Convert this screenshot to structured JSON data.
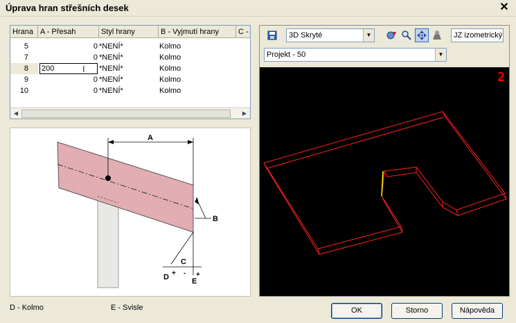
{
  "window": {
    "title": "Úprava hran střešních desek"
  },
  "grid": {
    "columns": [
      "Hrana",
      "A - Přesah",
      "Styl hrany",
      "B - Vyjmutí hrany",
      "C -"
    ],
    "rows": [
      {
        "hrana": "5",
        "presah": "0",
        "styl": "*NENÍ*",
        "vyjmuti": "Kolmo"
      },
      {
        "hrana": "7",
        "presah": "0",
        "styl": "*NENÍ*",
        "vyjmuti": "Kolmo"
      },
      {
        "hrana": "8",
        "presah": "",
        "styl": "*NENÍ*",
        "vyjmuti": "Kolmo",
        "edit_value": "200"
      },
      {
        "hrana": "9",
        "presah": "0",
        "styl": "*NENÍ*",
        "vyjmuti": "Kolmo"
      },
      {
        "hrana": "10",
        "presah": "0",
        "styl": "*NENÍ*",
        "vyjmuti": "Kolmo"
      }
    ]
  },
  "illustration": {
    "labels": {
      "a": "A",
      "b": "B",
      "c": "C",
      "d": "D",
      "e": "E"
    }
  },
  "legend": {
    "d": "D - Kolmo",
    "e": "E - Svisle"
  },
  "viewer": {
    "view_style": "3D Skryté",
    "view_name": "JZ izometrický",
    "project": "Projekt - 50",
    "viewport_number": "2",
    "icons": [
      "save-icon",
      "rotate-icon",
      "zoom-icon",
      "pan-icon",
      "walk-icon"
    ]
  },
  "buttons": {
    "ok": "OK",
    "cancel": "Storno",
    "help": "Nápověda"
  },
  "colors": {
    "wireframe": "#ff2020",
    "highlight": "#ffff00",
    "viewport_bg": "#000000"
  }
}
